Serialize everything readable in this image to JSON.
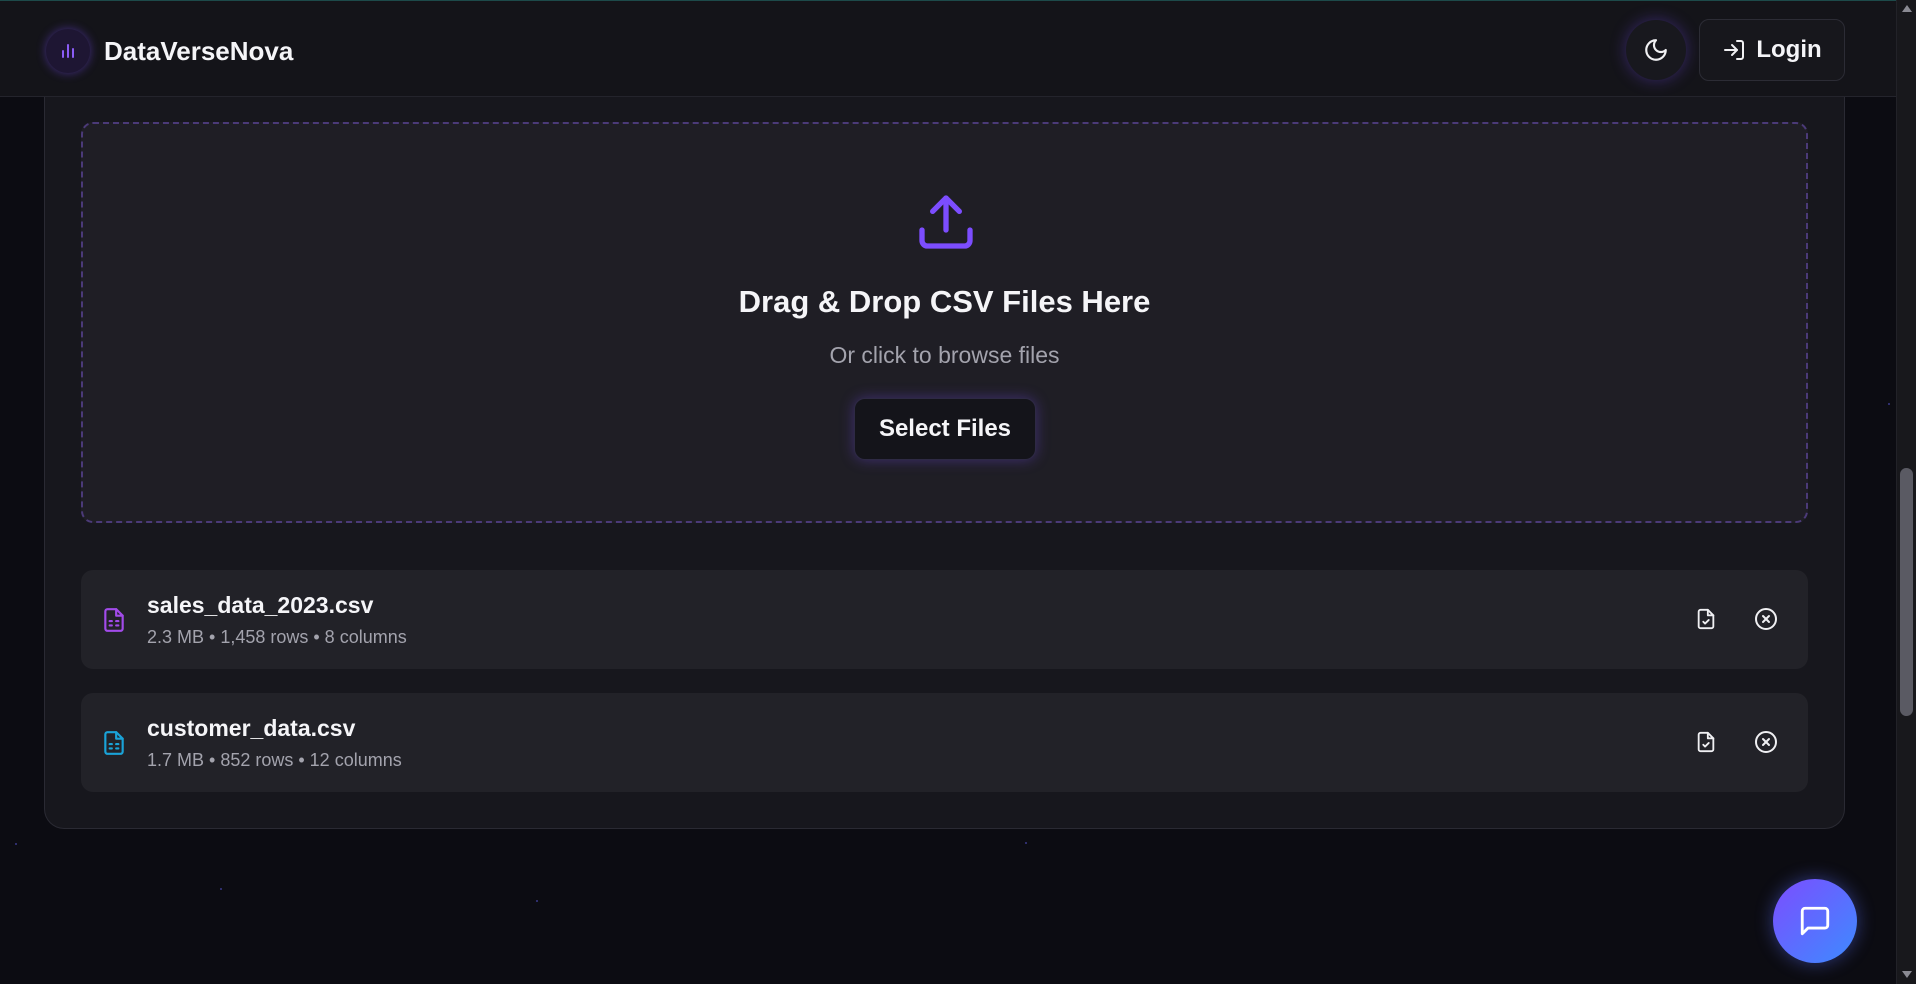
{
  "header": {
    "brand_name": "DataVerseNova",
    "login_label": "Login"
  },
  "upload": {
    "title": "Drag & Drop CSV Files Here",
    "subtitle": "Or click to browse files",
    "button_label": "Select Files"
  },
  "files": [
    {
      "name": "sales_data_2023.csv",
      "meta": "2.3 MB • 1,458 rows • 8 columns",
      "icon_color": "#a24bea"
    },
    {
      "name": "customer_data.csv",
      "meta": "1.7 MB • 852 rows • 12 columns",
      "icon_color": "#1aa3d8"
    }
  ],
  "colors": {
    "accent": "#7c4dff",
    "background": "#0c0c12",
    "panel": "#17171d"
  },
  "icons": {
    "brand": "bar-chart-icon",
    "theme": "moon-icon",
    "login": "log-in-icon",
    "upload": "upload-icon",
    "file": "file-spreadsheet-icon",
    "preview": "file-check-icon",
    "remove": "x-circle-icon",
    "chat": "message-square-icon"
  }
}
